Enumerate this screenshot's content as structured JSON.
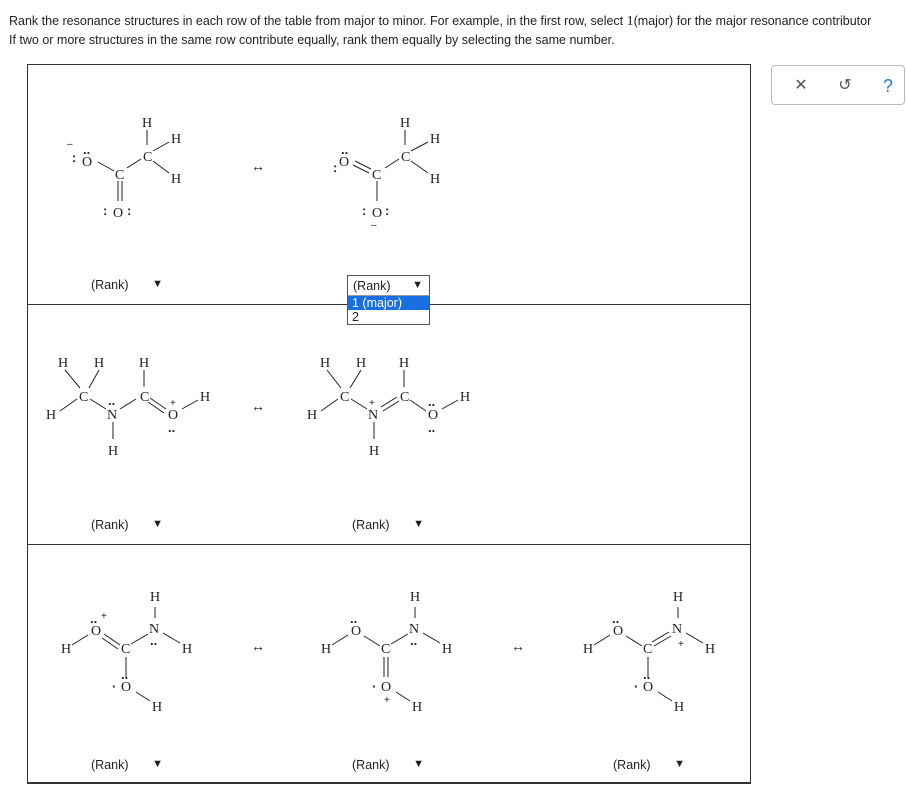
{
  "instructions": {
    "line1_before": "Rank the resonance structures in each row of the table from major to minor. For example, in the first row, select ",
    "line1_num": "1",
    "line1_after": "(major) for the major resonance contributor",
    "line2": "If two or more structures in the same row contribute equally, rank them equally by selecting the same number."
  },
  "rank_placeholder": "(Rank)",
  "dropdown_options": [
    "1 (major)",
    "2"
  ],
  "toolbar": {
    "clear": "✕",
    "undo": "↺",
    "help": "?"
  },
  "arrow_glyph": "↔",
  "atoms": {
    "H": "H",
    "C": "C",
    "O": "O",
    "N": "N"
  },
  "charges": {
    "minus": "–",
    "plus": "+"
  }
}
